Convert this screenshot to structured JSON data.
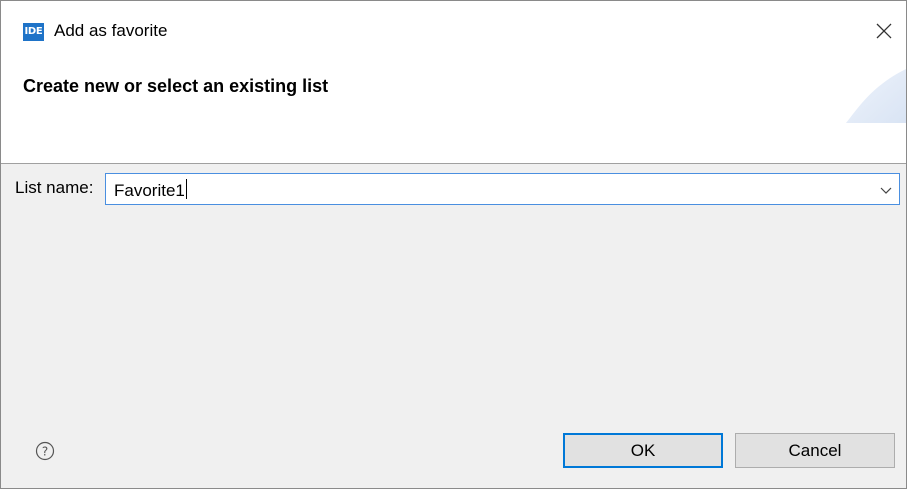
{
  "window": {
    "app_icon_text": "IDE",
    "title": "Add as favorite",
    "close_icon": "close-icon"
  },
  "header": {
    "title": "Create new or select an existing list"
  },
  "form": {
    "list_name_label": "List name:",
    "list_name_value": "Favorite1",
    "dropdown_icon": "chevron-down-icon"
  },
  "footer": {
    "help_icon": "help-icon",
    "ok_label": "OK",
    "cancel_label": "Cancel"
  },
  "colors": {
    "accent": "#0078d7",
    "app_icon_bg": "#1e73c8",
    "dialog_bg": "#f0f0f0"
  }
}
